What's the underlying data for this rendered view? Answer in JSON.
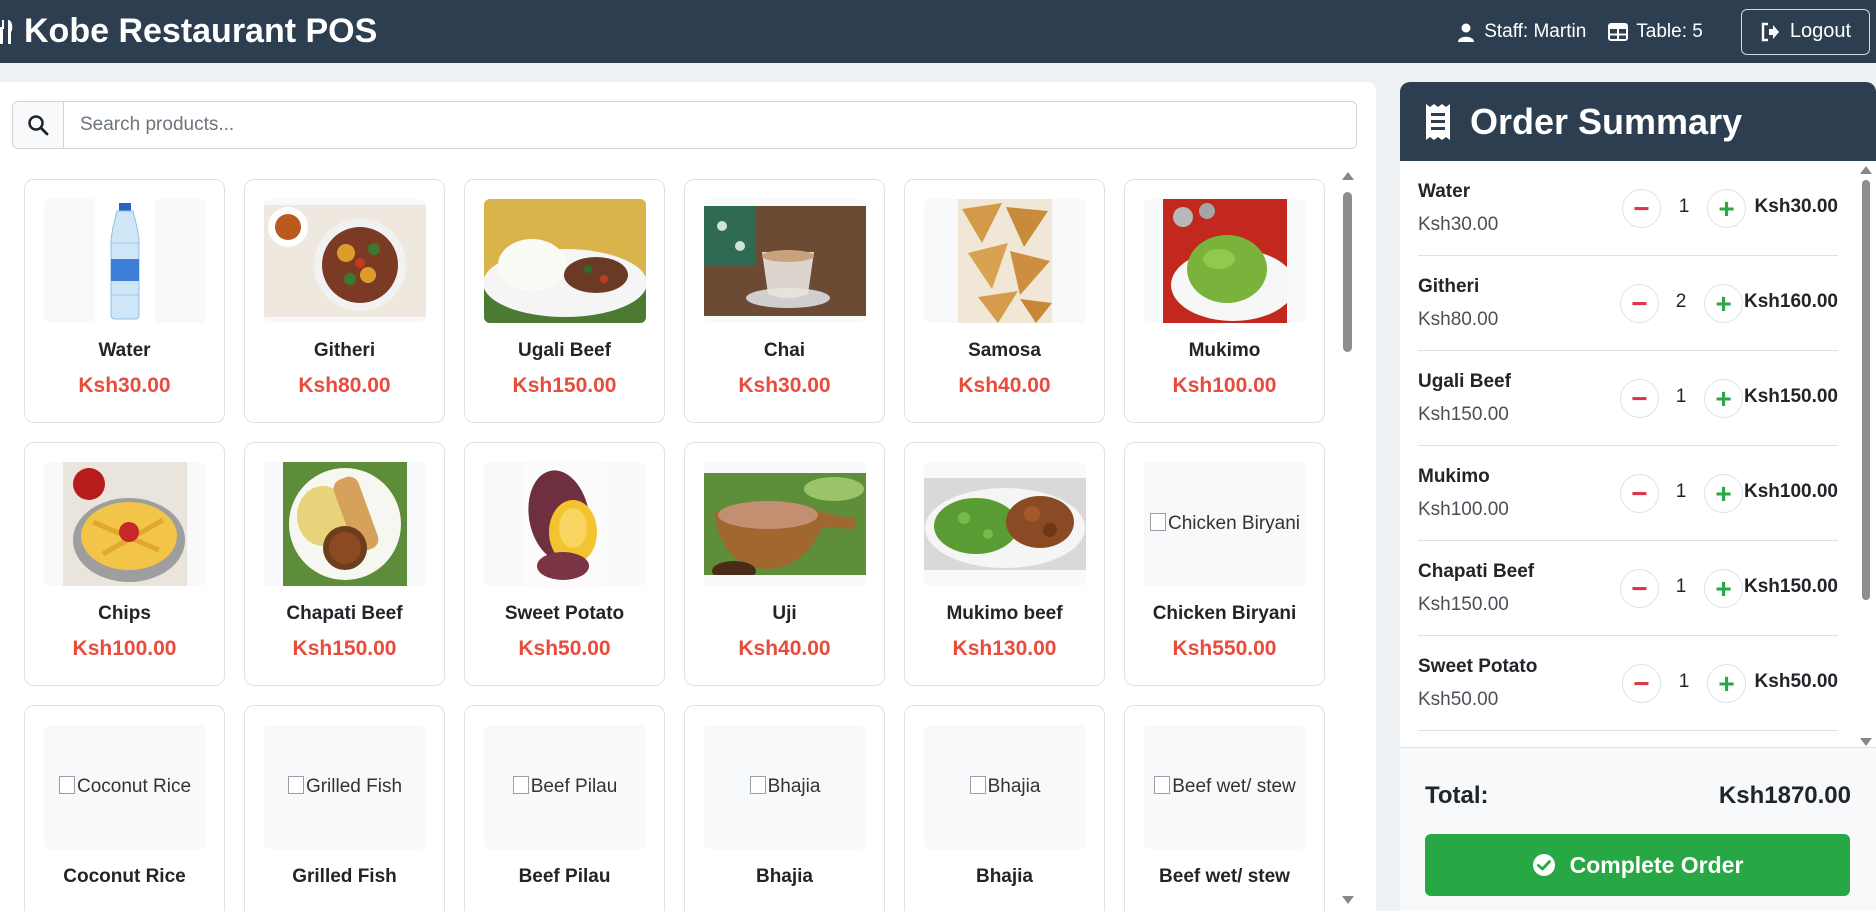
{
  "navbar": {
    "title": "Kobe Restaurant POS",
    "staff": "Staff: Martin",
    "table": "Table: 5",
    "logout_label": "Logout"
  },
  "search": {
    "placeholder": "Search products..."
  },
  "products": [
    {
      "name": "Water",
      "price": "Ksh30.00",
      "image": "water-bottle"
    },
    {
      "name": "Githeri",
      "price": "Ksh80.00",
      "image": "githeri-bowl"
    },
    {
      "name": "Ugali Beef",
      "price": "Ksh150.00",
      "image": "ugali-beef-plate"
    },
    {
      "name": "Chai",
      "price": "Ksh30.00",
      "image": "chai-cup"
    },
    {
      "name": "Samosa",
      "price": "Ksh40.00",
      "image": "samosa"
    },
    {
      "name": "Mukimo",
      "price": "Ksh100.00",
      "image": "mukimo-plate"
    },
    {
      "name": "Chips",
      "price": "Ksh100.00",
      "image": "chips-bowl"
    },
    {
      "name": "Chapati Beef",
      "price": "Ksh150.00",
      "image": "chapati-beef-plate"
    },
    {
      "name": "Sweet Potato",
      "price": "Ksh50.00",
      "image": "sweet-potato"
    },
    {
      "name": "Uji",
      "price": "Ksh40.00",
      "image": "uji-gourd"
    },
    {
      "name": "Mukimo beef",
      "price": "Ksh130.00",
      "image": "mukimo-beef-plate"
    },
    {
      "name": "Chicken Biryani",
      "price": "Ksh550.00",
      "image": null,
      "alt": "Chicken Biryani"
    },
    {
      "name": "Coconut Rice",
      "price": "",
      "image": null,
      "alt": "Coconut Rice"
    },
    {
      "name": "Grilled Fish",
      "price": "",
      "image": null,
      "alt": "Grilled Fish"
    },
    {
      "name": "Beef Pilau",
      "price": "",
      "image": null,
      "alt": "Beef Pilau"
    },
    {
      "name": "Bhajia",
      "price": "",
      "image": null,
      "alt": "Bhajia"
    },
    {
      "name": "Bhajia",
      "price": "",
      "image": null,
      "alt": "Bhajia"
    },
    {
      "name": "Beef wet/ stew",
      "price": "",
      "image": null,
      "alt": "Beef wet/ stew"
    }
  ],
  "order": {
    "title": "Order Summary",
    "items": [
      {
        "name": "Water",
        "unit_price": "Ksh30.00",
        "qty": "1",
        "line_total": "Ksh30.00"
      },
      {
        "name": "Githeri",
        "unit_price": "Ksh80.00",
        "qty": "2",
        "line_total": "Ksh160.00"
      },
      {
        "name": "Ugali Beef",
        "unit_price": "Ksh150.00",
        "qty": "1",
        "line_total": "Ksh150.00"
      },
      {
        "name": "Mukimo",
        "unit_price": "Ksh100.00",
        "qty": "1",
        "line_total": "Ksh100.00"
      },
      {
        "name": "Chapati Beef",
        "unit_price": "Ksh150.00",
        "qty": "1",
        "line_total": "Ksh150.00"
      },
      {
        "name": "Sweet Potato",
        "unit_price": "Ksh50.00",
        "qty": "1",
        "line_total": "Ksh50.00"
      }
    ],
    "minus_symbol": "−",
    "plus_symbol": "+",
    "total_label": "Total:",
    "total_value": "Ksh1870.00",
    "complete_label": "Complete Order"
  },
  "colors": {
    "navbar": "#2c3e50",
    "price": "#e74c3c",
    "success": "#28a745",
    "danger": "#dc3545"
  },
  "icons": {
    "brand": "utensils-icon",
    "staff": "user-icon",
    "table": "table-icon",
    "logout": "sign-out-icon",
    "search": "search-icon",
    "order": "receipt-icon",
    "complete": "check-circle-icon"
  }
}
